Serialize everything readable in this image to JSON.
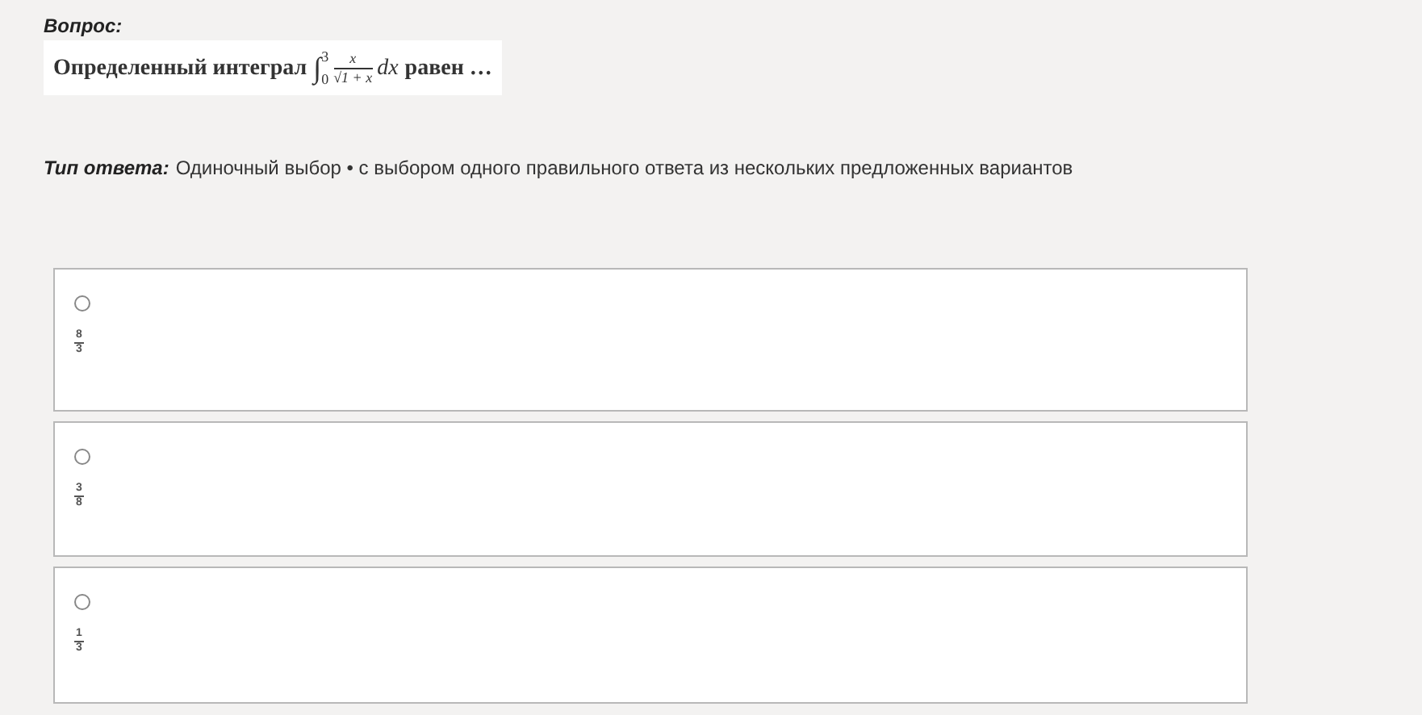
{
  "question": {
    "label": "Вопрос:",
    "text": "Определенный интеграл",
    "integral": {
      "symbol": "∫",
      "lower": "0",
      "upper": "3",
      "numerator": "x",
      "denominator": "√1 + x",
      "differential": "dx"
    },
    "suffix": "равен …"
  },
  "answer_type": {
    "label": "Тип ответа:",
    "value": "Одиночный выбор • с выбором одного правильного ответа из нескольких предложенных вариантов"
  },
  "options": [
    {
      "numerator": "8",
      "denominator": "3",
      "selected": false
    },
    {
      "numerator": "3",
      "denominator": "8",
      "selected": false
    },
    {
      "numerator": "1",
      "denominator": "3",
      "selected": false
    }
  ]
}
